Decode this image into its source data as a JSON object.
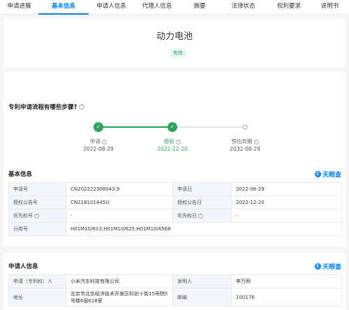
{
  "tabs": [
    {
      "label": "申请进展"
    },
    {
      "label": "基本信息"
    },
    {
      "label": "申请人信息"
    },
    {
      "label": "代理人信息"
    },
    {
      "label": "摘要"
    },
    {
      "label": "法律状态"
    },
    {
      "label": "权利要求"
    },
    {
      "label": "说明书"
    }
  ],
  "header": {
    "title": "动力电池",
    "status": "有效"
  },
  "faq": {
    "text": "专利申请流程有哪些步骤?"
  },
  "timeline": [
    {
      "label": "申请",
      "date": "2022-08-29"
    },
    {
      "label": "授权",
      "date": "2022-12-20"
    },
    {
      "label": "预估到期",
      "date": "2032-08-29"
    }
  ],
  "basic_info": {
    "title": "基本信息",
    "brand": "天眼查",
    "rows": [
      {
        "k1": "申请号",
        "v1": "CN202222308043.9",
        "k2": "申请日",
        "v2": "2022-08-29"
      },
      {
        "k1": "授权公告号",
        "v1": "CN218101445U",
        "k2": "授权公告日",
        "v2": "2022-12-20"
      },
      {
        "k1": "优先权号",
        "v1": "-",
        "k2": "优先权日",
        "v2": "-"
      },
      {
        "k1": "分类号",
        "v1": "H01M10/613;H01M10/625;H01M10/6568"
      }
    ]
  },
  "applicant_info": {
    "title": "申请人信息",
    "brand": "天眼查",
    "rows": [
      {
        "k1": "申请（专利权）人",
        "v1": "小米汽车科技有限公司",
        "k2": "发明人",
        "v2": "李万明"
      },
      {
        "k1": "地址",
        "v1": "北京市北京经济技术开发区科创十街15号院5号楼6层618室",
        "k2": "邮编",
        "v2": "100176"
      }
    ]
  },
  "colors": {
    "accent": "#0084ff",
    "success": "#2aa455"
  }
}
